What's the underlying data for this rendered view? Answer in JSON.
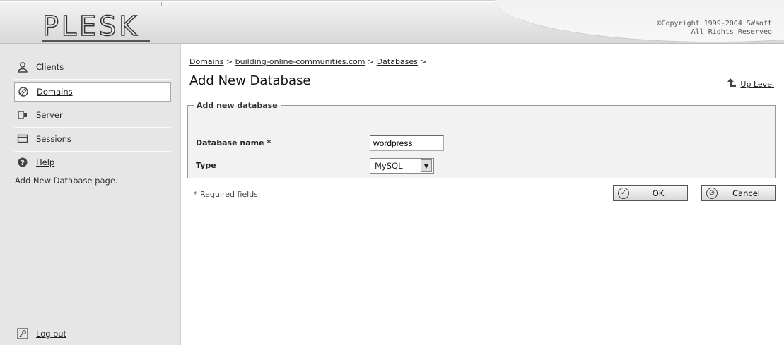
{
  "header": {
    "logo": "PLESK",
    "copyright_line1": "©Copyright 1999-2004 SWsoft",
    "copyright_line2": "All Rights Reserved"
  },
  "sidebar": {
    "items": [
      {
        "label": "Clients",
        "icon": "clients-icon"
      },
      {
        "label": "Domains",
        "icon": "domains-icon",
        "active": true
      },
      {
        "label": "Server",
        "icon": "server-icon"
      },
      {
        "label": "Sessions",
        "icon": "sessions-icon"
      },
      {
        "label": "Help",
        "icon": "help-icon"
      }
    ],
    "help_text": "Add New Database page.",
    "logout_label": "Log out"
  },
  "breadcrumb": {
    "items": [
      "Domains",
      "building-online-communities.com",
      "Databases"
    ],
    "separator": ">"
  },
  "page": {
    "title": "Add New Database",
    "up_level": "Up Level"
  },
  "form": {
    "legend": "Add new database",
    "db_name_label": "Database name *",
    "db_name_value": "wordpress",
    "type_label": "Type",
    "type_value": "MySQL",
    "required_note": "* Required fields",
    "ok_label": "OK",
    "cancel_label": "Cancel"
  }
}
